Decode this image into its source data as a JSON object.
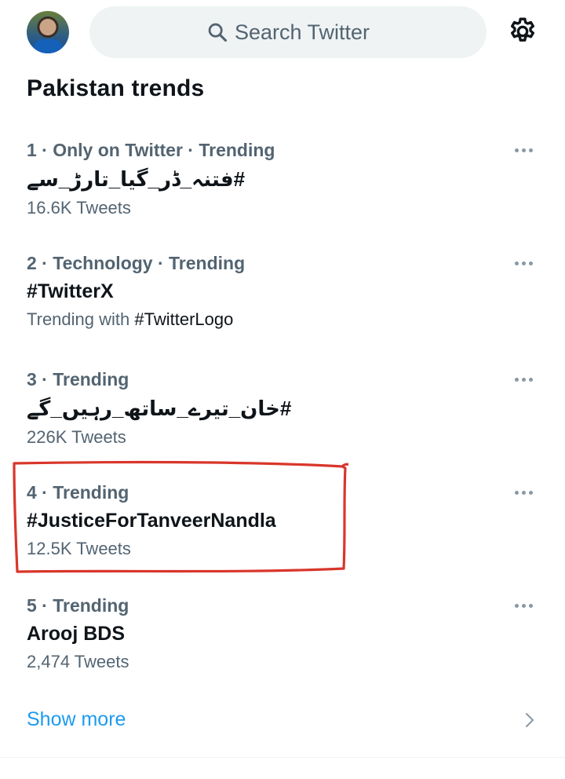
{
  "header": {
    "search_placeholder": "Search Twitter",
    "settings_icon": "gear-icon",
    "search_icon": "search-icon"
  },
  "section": {
    "title": "Pakistan trends"
  },
  "trends": [
    {
      "meta": "1 · Only on Twitter · Trending",
      "name": "#فتنہ_ڈر_گیا_تارڑ_سے",
      "sub": "16.6K Tweets"
    },
    {
      "meta": "2 · Technology · Trending",
      "name": "#TwitterX",
      "sub_prefix": "Trending with ",
      "sub_tag": "#TwitterLogo"
    },
    {
      "meta": "3 · Trending",
      "name": "#خان_تیرے_ساتھ_رہیں_گے",
      "sub": "226K Tweets"
    },
    {
      "meta": "4 · Trending",
      "name": "#JusticeForTanveerNandla",
      "sub": "12.5K Tweets"
    },
    {
      "meta": "5 · Trending",
      "name": "Arooj BDS",
      "sub": "2,474 Tweets"
    }
  ],
  "footer": {
    "show_more": "Show more"
  },
  "colors": {
    "accent": "#1d9bf0",
    "highlight_stroke": "#d9362b",
    "secondary_text": "#536471"
  }
}
